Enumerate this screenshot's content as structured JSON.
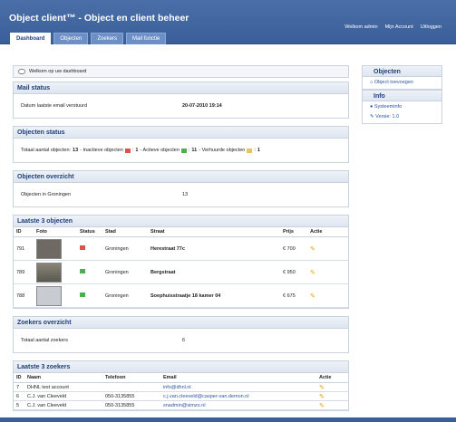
{
  "header": {
    "title": "Object client™ - Object en client beheer",
    "welcome": "Welkom admin",
    "account": "Mijn Account",
    "logout": "Uitloggen"
  },
  "tabs": [
    "Dashboard",
    "Objecten",
    "Zoekers",
    "Mail functie"
  ],
  "welcome_msg": "Welkom op uw dashboard",
  "mail_status": {
    "title": "Mail status",
    "label": "Datum laatste email verstuurd",
    "value": "20-07-2010 19:14"
  },
  "objecten_status": {
    "title": "Objecten status",
    "total_label": "Totaal aantal objecten:",
    "total": "13",
    "inactive_label": "- Inactieve objecten",
    "inactive": "1",
    "active_label": "- Actieve objecten",
    "active": "11",
    "rented_label": "- Verhuurde objecten",
    "rented": "1"
  },
  "objecten_overzicht": {
    "title": "Objecten overzicht",
    "label": "Objecten in Groningen",
    "value": "13"
  },
  "laatste_objecten": {
    "title": "Laatste 3 objecten",
    "headers": [
      "ID",
      "Foto",
      "Status",
      "Stad",
      "Straat",
      "Prijs",
      "Actie"
    ],
    "rows": [
      {
        "id": "791",
        "stad": "Groningen",
        "straat": "Herestraat 77c",
        "prijs": "€ 700",
        "status_color": "#d9534f"
      },
      {
        "id": "789",
        "stad": "Groningen",
        "straat": "Bergstraat",
        "prijs": "€ 950",
        "status_color": "#4cae4c"
      },
      {
        "id": "788",
        "stad": "Groningen",
        "straat": "Soephuisstraatje 18 kamer 04",
        "prijs": "€ 675",
        "status_color": "#4cae4c"
      }
    ]
  },
  "zoekers_overzicht": {
    "title": "Zoekers overzicht",
    "label": "Totaal aantal zoekers",
    "value": "6"
  },
  "laatste_zoekers": {
    "title": "Laatste 3 zoekers",
    "headers": [
      "ID",
      "Naam",
      "Telefoon",
      "Email",
      "Actie"
    ],
    "rows": [
      {
        "id": "7",
        "naam": "DHNL test account",
        "telefoon": "",
        "email": "info@dhnl.nl"
      },
      {
        "id": "6",
        "naam": "C.J. van Cleeveld",
        "telefoon": "050-3135855",
        "email": "c.j.van.cleeveld@casper-van.demon.nl"
      },
      {
        "id": "5",
        "naam": "C.J. van Cleeveld",
        "telefoon": "050-3135855",
        "email": "snadmin@simzo.nl"
      }
    ]
  },
  "sidebar": {
    "objecten_title": "Objecten",
    "objecten_add": "Object toevoegen",
    "info_title": "Info",
    "systeeminfo": "Systeeminfo",
    "versie": "Versie: 1.0"
  },
  "colors": {
    "header": "#3a5e99",
    "inactive_flag": "#d9534f",
    "active_flag": "#4cae4c",
    "rented_flag": "#e6c65a"
  }
}
